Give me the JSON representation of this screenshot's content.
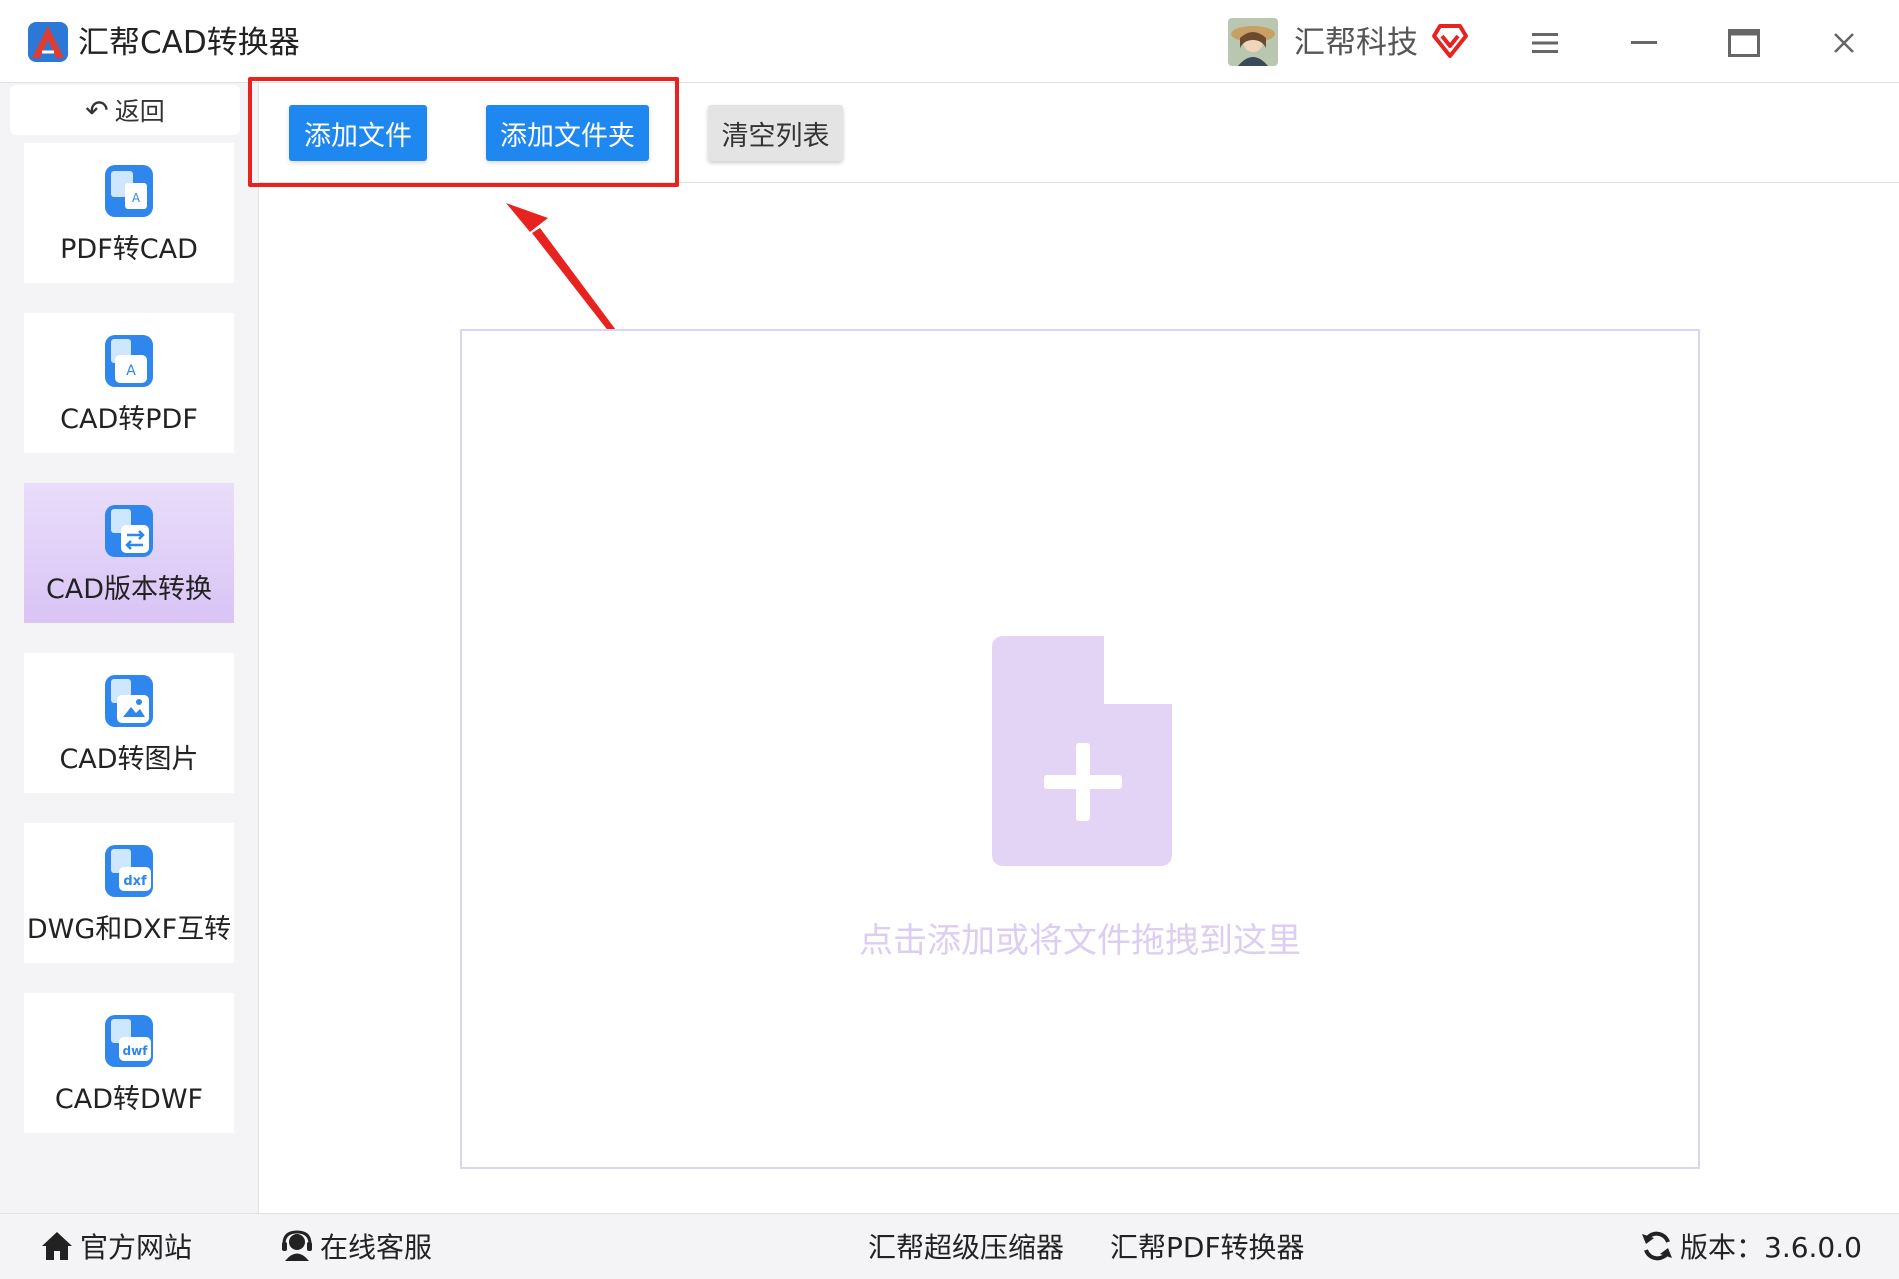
{
  "titlebar": {
    "app_title": "汇帮CAD转换器",
    "user_name": "汇帮科技",
    "logo_icon": "app-logo-icon",
    "avatar_icon": "user-avatar",
    "vip_icon": "vip-heart-icon",
    "menu_icon": "hamburger-menu-icon",
    "minimize_icon": "minimize-icon",
    "maximize_icon": "maximize-icon",
    "close_icon": "close-icon"
  },
  "sidebar": {
    "back_label": "返回",
    "items": [
      {
        "label": "PDF转CAD",
        "icon": "pdf-to-cad-icon",
        "active": false
      },
      {
        "label": "CAD转PDF",
        "icon": "cad-to-pdf-icon",
        "active": false
      },
      {
        "label": "CAD版本转换",
        "icon": "cad-version-icon",
        "active": true
      },
      {
        "label": "CAD转图片",
        "icon": "cad-to-image-icon",
        "active": false
      },
      {
        "label": "DWG和DXF互转",
        "icon": "dwg-dxf-icon",
        "active": false
      },
      {
        "label": "CAD转DWF",
        "icon": "cad-to-dwf-icon",
        "active": false
      }
    ]
  },
  "toolbar": {
    "add_file_label": "添加文件",
    "add_folder_label": "添加文件夹",
    "clear_list_label": "清空列表"
  },
  "dropzone": {
    "hint": "点击添加或将文件拖拽到这里",
    "icon": "file-add-icon"
  },
  "footer": {
    "official_site": "官方网站",
    "online_service": "在线客服",
    "compressor": "汇帮超级压缩器",
    "pdf_converter": "汇帮PDF转换器",
    "version": "版本：3.6.0.0"
  },
  "colors": {
    "primary": "#1e87f0",
    "highlight": "#e8231f",
    "active_nav": "#dccaf6",
    "drop_icon": "#e3d3f5"
  }
}
